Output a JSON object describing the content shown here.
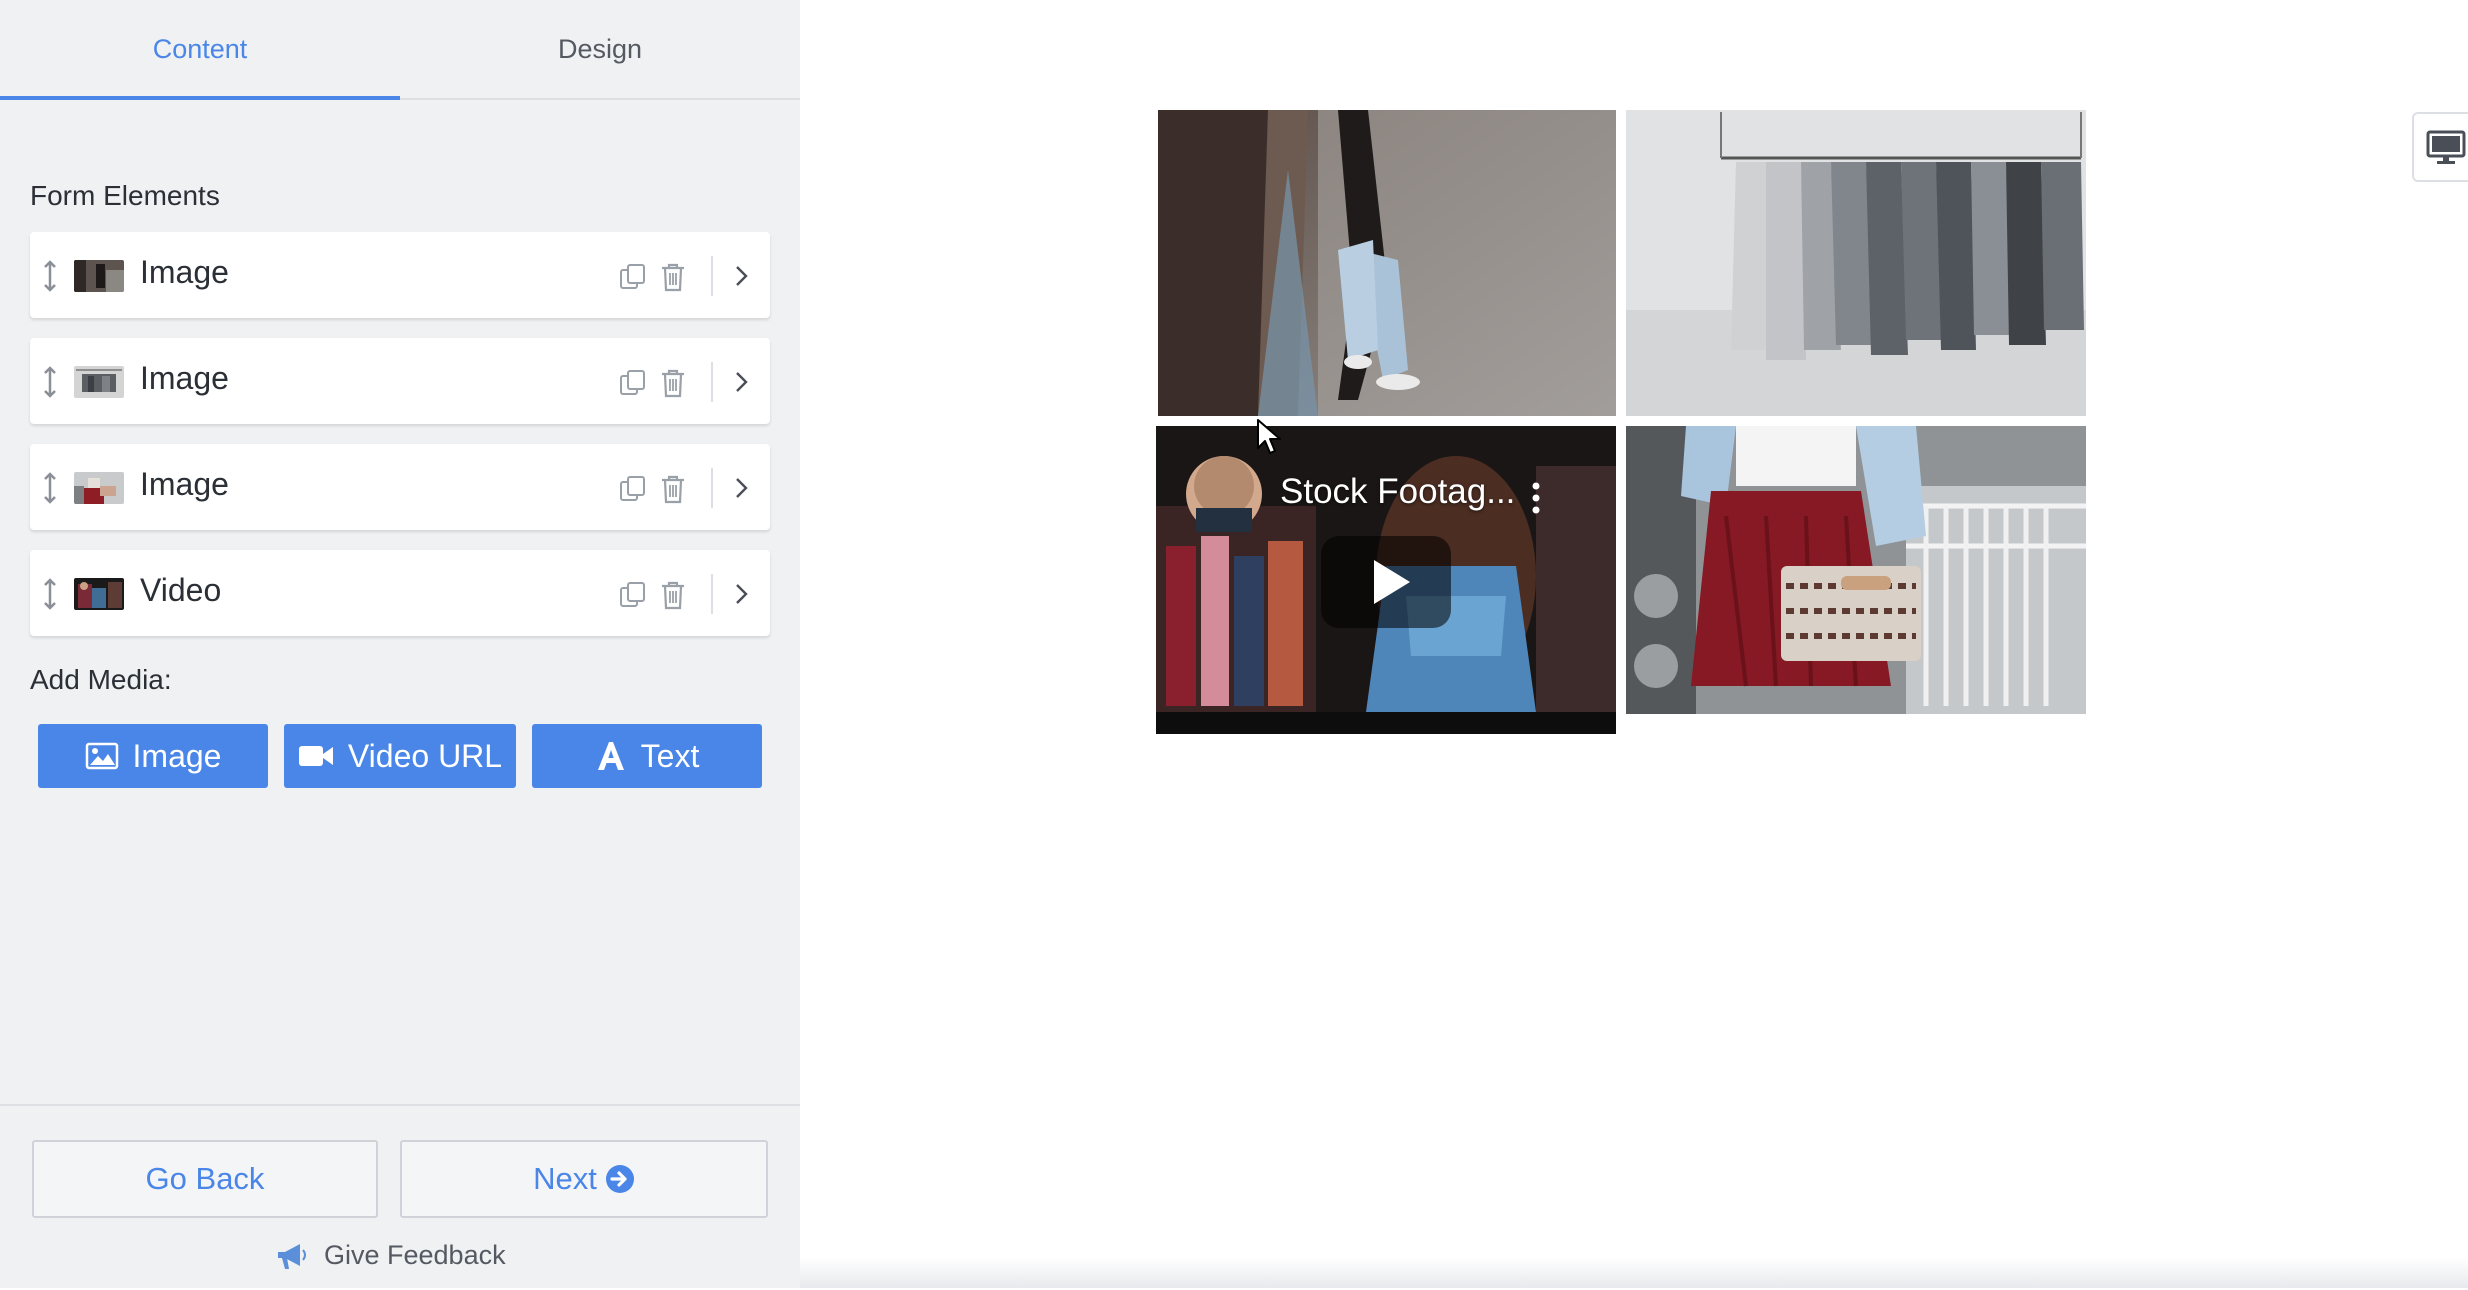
{
  "tabs": [
    {
      "label": "Content",
      "active": true
    },
    {
      "label": "Design",
      "active": false
    }
  ],
  "form_elements": {
    "title": "Form Elements",
    "items": [
      {
        "label": "Image",
        "thumb": "image-thumb-icon"
      },
      {
        "label": "Image",
        "thumb": "image-thumb-icon"
      },
      {
        "label": "Image",
        "thumb": "image-thumb-icon"
      },
      {
        "label": "Video",
        "thumb": "video-thumb-icon"
      }
    ]
  },
  "add_media": {
    "title": "Add Media:",
    "image_label": "Image",
    "video_label": "Video URL",
    "text_label": "Text"
  },
  "footer": {
    "back_label": "Go Back",
    "next_label": "Next",
    "feedback_label": "Give Feedback"
  },
  "preview": {
    "video_title": "Stock Footag..."
  },
  "colors": {
    "accent": "#4a86e8",
    "sidebar_bg": "#f0f1f3"
  }
}
